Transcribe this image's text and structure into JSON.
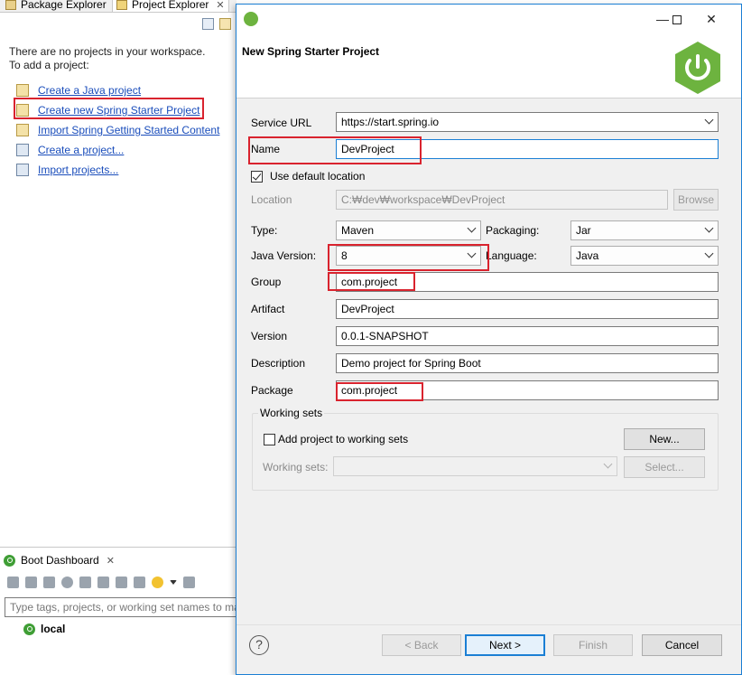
{
  "workbench": {
    "tabs": [
      {
        "label": "Package Explorer",
        "icon": "package-explorer-icon"
      },
      {
        "label": "Project Explorer",
        "icon": "project-explorer-icon"
      }
    ],
    "empty_message_1": "There are no projects in your workspace.",
    "empty_message_2": "To add a project:",
    "links": [
      {
        "label": "Create a Java project",
        "icon": "java-project-icon"
      },
      {
        "label": "Create new Spring Starter Project",
        "icon": "spring-starter-icon"
      },
      {
        "label": "Import Spring Getting Started Content",
        "icon": "import-content-icon"
      },
      {
        "label": "Create a project...",
        "icon": "new-project-icon"
      },
      {
        "label": "Import projects...",
        "icon": "import-projects-icon"
      }
    ],
    "boot_dashboard": {
      "tab_label": "Boot Dashboard",
      "filter_placeholder": "Type tags, projects, or working set names to match",
      "local_label": "local"
    }
  },
  "dialog": {
    "title": "New Spring Starter Project",
    "form": {
      "service_url_label": "Service URL",
      "service_url_value": "https://start.spring.io",
      "name_label": "Name",
      "name_value": "DevProject",
      "use_default_location_label": "Use default location",
      "use_default_location_checked": true,
      "location_label": "Location",
      "location_value": "C:₩dev₩workspace₩DevProject",
      "browse_label": "Browse",
      "type_label": "Type:",
      "type_value": "Maven",
      "packaging_label": "Packaging:",
      "packaging_value": "Jar",
      "java_version_label": "Java Version:",
      "java_version_value": "8",
      "language_label": "Language:",
      "language_value": "Java",
      "group_label": "Group",
      "group_value": "com.project",
      "artifact_label": "Artifact",
      "artifact_value": "DevProject",
      "version_label": "Version",
      "version_value": "0.0.1-SNAPSHOT",
      "description_label": "Description",
      "description_value": "Demo project for Spring Boot",
      "package_label": "Package",
      "package_value": "com.project"
    },
    "working_sets": {
      "group_title": "Working sets",
      "add_label": "Add project to working sets",
      "add_checked": false,
      "new_label": "New...",
      "working_sets_label": "Working sets:",
      "select_label": "Select..."
    },
    "buttons": {
      "help_glyph": "?",
      "back": "< Back",
      "next": "Next >",
      "finish": "Finish",
      "cancel": "Cancel"
    }
  },
  "colors": {
    "spring_green": "#6db33f",
    "highlight_red": "#d9232e",
    "link_blue": "#1a4dbb",
    "focus_blue": "#1b7fd4"
  }
}
